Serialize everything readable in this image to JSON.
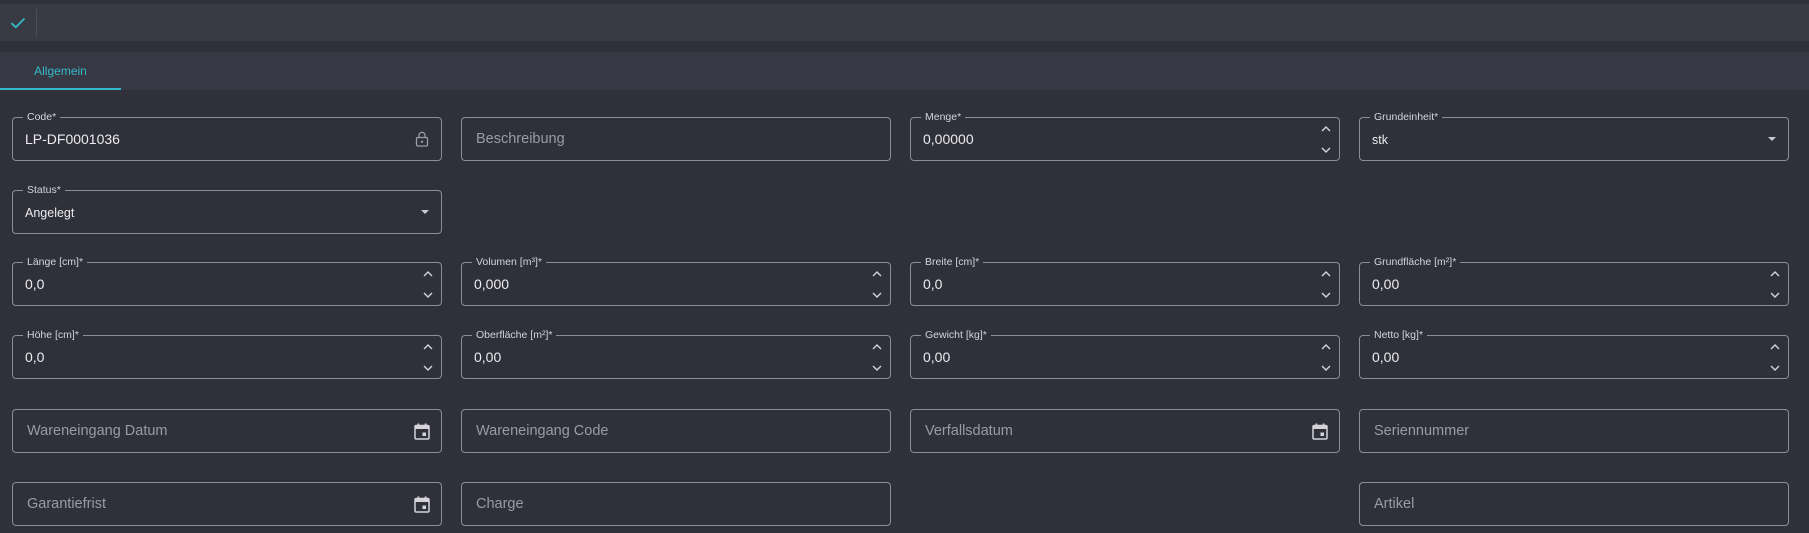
{
  "toolbar": {
    "icons": [
      "check-icon"
    ]
  },
  "tabs": [
    {
      "label": "Allgemein",
      "active": true
    }
  ],
  "accent_color": "#35b9c9",
  "fields": {
    "code": {
      "label": "Code*",
      "value": "LP-DF0001036",
      "icon": "lock-icon"
    },
    "beschreibung": {
      "placeholder": "Beschreibung"
    },
    "menge": {
      "label": "Menge*",
      "value": "0,00000"
    },
    "grundeinheit": {
      "label": "Grundeinheit*",
      "value": "stk"
    },
    "status": {
      "label": "Status*",
      "value": "Angelegt"
    },
    "laenge": {
      "label": "Länge [cm]*",
      "value": "0,0"
    },
    "volumen": {
      "label": "Volumen [m³]*",
      "value": "0,000"
    },
    "breite": {
      "label": "Breite [cm]*",
      "value": "0,0"
    },
    "grundflaeche": {
      "label": "Grundfläche [m²]*",
      "value": "0,00"
    },
    "hoehe": {
      "label": "Höhe [cm]*",
      "value": "0,0"
    },
    "oberflaeche": {
      "label": "Oberfläche [m²]*",
      "value": "0,00"
    },
    "gewicht": {
      "label": "Gewicht [kg]*",
      "value": "0,00"
    },
    "netto": {
      "label": "Netto [kg]*",
      "value": "0,00"
    },
    "wareneingang_datum": {
      "placeholder": "Wareneingang Datum",
      "icon": "calendar-icon"
    },
    "wareneingang_code": {
      "placeholder": "Wareneingang Code"
    },
    "verfallsdatum": {
      "placeholder": "Verfallsdatum",
      "icon": "calendar-icon"
    },
    "seriennummer": {
      "placeholder": "Seriennummer"
    },
    "garantiefrist": {
      "placeholder": "Garantiefrist",
      "icon": "calendar-icon"
    },
    "charge": {
      "placeholder": "Charge"
    },
    "artikel": {
      "placeholder": "Artikel"
    }
  }
}
